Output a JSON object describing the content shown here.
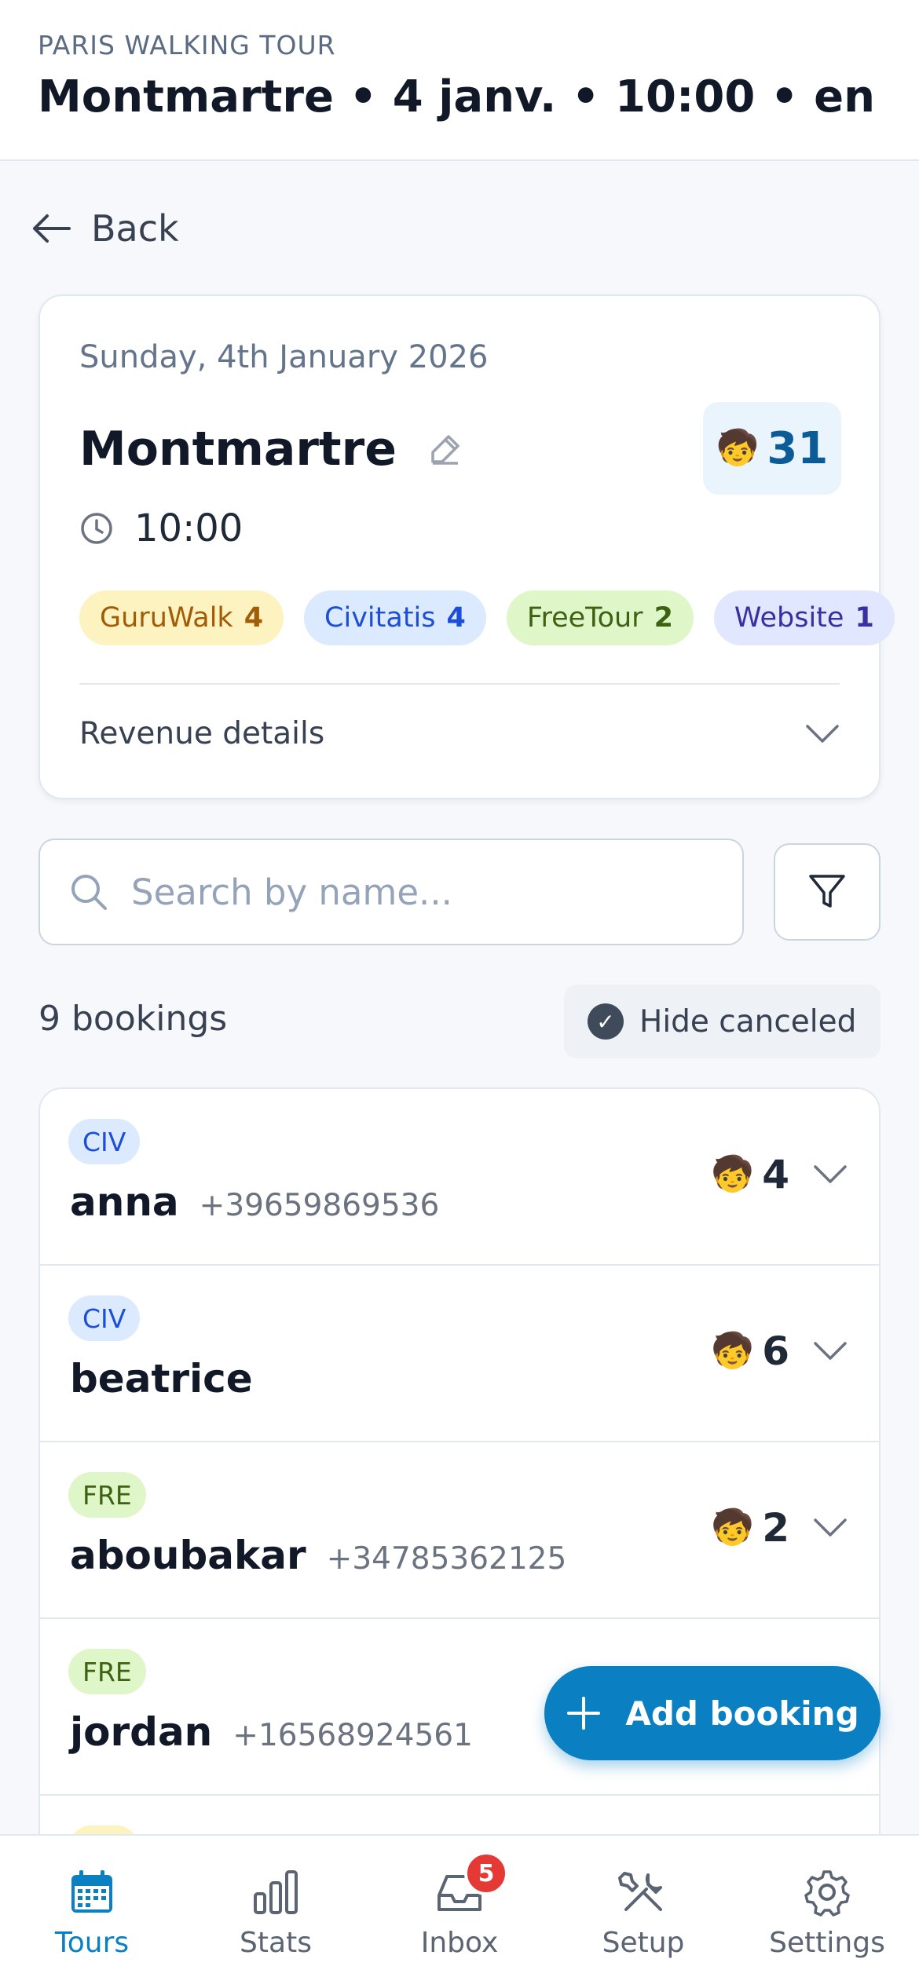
{
  "header": {
    "subtitle": "PARIS WALKING TOUR",
    "title": "Montmartre • 4 janv. • 10:00 • en"
  },
  "back_label": "Back",
  "tour_card": {
    "date": "Sunday, 4th January 2026",
    "name": "Montmartre",
    "total_pax": "31",
    "time": "10:00",
    "sources": [
      {
        "label": "GuruWalk",
        "count": "4",
        "bg": "#fdf3c0",
        "fg": "#a15c07"
      },
      {
        "label": "Civitatis",
        "count": "4",
        "bg": "#dbeafe",
        "fg": "#1d4ed8"
      },
      {
        "label": "FreeTour",
        "count": "2",
        "bg": "#dff7c8",
        "fg": "#3f6212"
      },
      {
        "label": "Website",
        "count": "1",
        "bg": "#e0e7ff",
        "fg": "#3730a3"
      }
    ],
    "revenue_label": "Revenue details"
  },
  "search": {
    "placeholder": "Search by name..."
  },
  "bookings_count": "9 bookings",
  "hide_canceled_label": "Hide canceled",
  "bookings": [
    {
      "tag": "CIV",
      "tag_bg": "#dbeafe",
      "tag_fg": "#1d4ed8",
      "name": "anna",
      "phone": "+39659869536",
      "pax": "4"
    },
    {
      "tag": "CIV",
      "tag_bg": "#dbeafe",
      "tag_fg": "#1d4ed8",
      "name": "beatrice",
      "phone": "",
      "pax": "6"
    },
    {
      "tag": "FRE",
      "tag_bg": "#dff7c8",
      "tag_fg": "#3f6212",
      "name": "aboubakar",
      "phone": "+34785362125",
      "pax": "2"
    },
    {
      "tag": "FRE",
      "tag_bg": "#dff7c8",
      "tag_fg": "#3f6212",
      "name": "jordan",
      "phone": "+16568924561",
      "pax": ""
    }
  ],
  "fab_label": "Add booking",
  "tabs": [
    {
      "label": "Tours",
      "icon": "calendar-icon",
      "active": true
    },
    {
      "label": "Stats",
      "icon": "bar-chart-icon"
    },
    {
      "label": "Inbox",
      "icon": "inbox-icon",
      "badge": "5"
    },
    {
      "label": "Setup",
      "icon": "tools-icon"
    },
    {
      "label": "Settings",
      "icon": "gear-icon"
    }
  ],
  "colors": {
    "accent": "#0a7fc2",
    "badge": "#e53935"
  }
}
